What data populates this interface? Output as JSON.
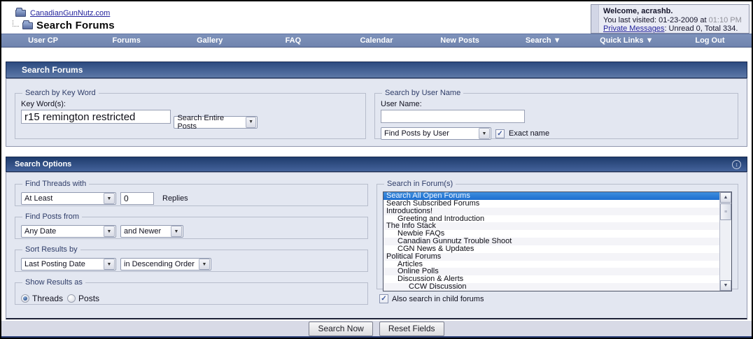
{
  "breadcrumb": {
    "site_link": "CanadianGunNutz.com",
    "page_title": "Search Forums"
  },
  "welcome": {
    "greeting": "Welcome, acrashb.",
    "last_visited_label": "You last visited: 01-23-2009 at",
    "last_visited_time": "01:10 PM",
    "pm_link": "Private Messages",
    "pm_status": ": Unread 0, Total 334."
  },
  "nav": {
    "items": [
      {
        "label": "User CP"
      },
      {
        "label": "Forums"
      },
      {
        "label": "Gallery"
      },
      {
        "label": "FAQ"
      },
      {
        "label": "Calendar"
      },
      {
        "label": "New Posts"
      },
      {
        "label": "Search ▼"
      },
      {
        "label": "Quick Links ▼"
      },
      {
        "label": "Log Out"
      }
    ]
  },
  "sections": {
    "search_forums": "Search Forums",
    "search_options": "Search Options",
    "collapse_glyph": "↕"
  },
  "keyword": {
    "legend": "Search by Key Word",
    "label": "Key Word(s):",
    "value": "r15 remington restricted",
    "scope_select": "Search Entire Posts"
  },
  "username": {
    "legend": "Search by User Name",
    "label": "User Name:",
    "value": "",
    "mode_select": "Find Posts by User",
    "exact_label": "Exact name",
    "exact_checked": "✓"
  },
  "threads_with": {
    "legend": "Find Threads with",
    "quantifier": "At Least",
    "count": "0",
    "suffix": "Replies"
  },
  "posts_from": {
    "legend": "Find Posts from",
    "date": "Any Date",
    "direction": "and Newer"
  },
  "sort": {
    "legend": "Sort Results by",
    "field": "Last Posting Date",
    "order": "in Descending Order"
  },
  "show_as": {
    "legend": "Show Results as",
    "label": "Show Results as",
    "options": [
      {
        "label": "Threads",
        "selected": true
      },
      {
        "label": "Posts",
        "selected": false
      }
    ]
  },
  "forums": {
    "legend": "Search in Forum(s)",
    "items": [
      {
        "label": "Search All Open Forums",
        "indent": 0,
        "selected": true
      },
      {
        "label": "Search Subscribed Forums",
        "indent": 0
      },
      {
        "label": "Introductions!",
        "indent": 0
      },
      {
        "label": "Greeting and Introduction",
        "indent": 1
      },
      {
        "label": "The Info Stack",
        "indent": 0
      },
      {
        "label": "Newbie FAQs",
        "indent": 1
      },
      {
        "label": "Canadian Gunnutz Trouble Shoot",
        "indent": 1
      },
      {
        "label": "CGN News & Updates",
        "indent": 1
      },
      {
        "label": "Political Forums",
        "indent": 0
      },
      {
        "label": "Articles",
        "indent": 1
      },
      {
        "label": "Online Polls",
        "indent": 1
      },
      {
        "label": "Discussion & Alerts",
        "indent": 1
      },
      {
        "label": "CCW Discussion",
        "indent": 2
      }
    ],
    "child_label": "Also search in child forums",
    "child_checked": "✓",
    "scroll_up_glyph": "▲",
    "scroll_down_glyph": "▼",
    "thumb_grip_glyph": "≡"
  },
  "selects_arrow_glyph": "▼",
  "actions": {
    "search": "Search Now",
    "reset": "Reset Fields"
  },
  "colors": {
    "accent_selected": "#2f80d9",
    "nav_bg": "#7589b1",
    "header_dark": "#1f3c6d",
    "panel_bg": "#e3e7f1"
  }
}
